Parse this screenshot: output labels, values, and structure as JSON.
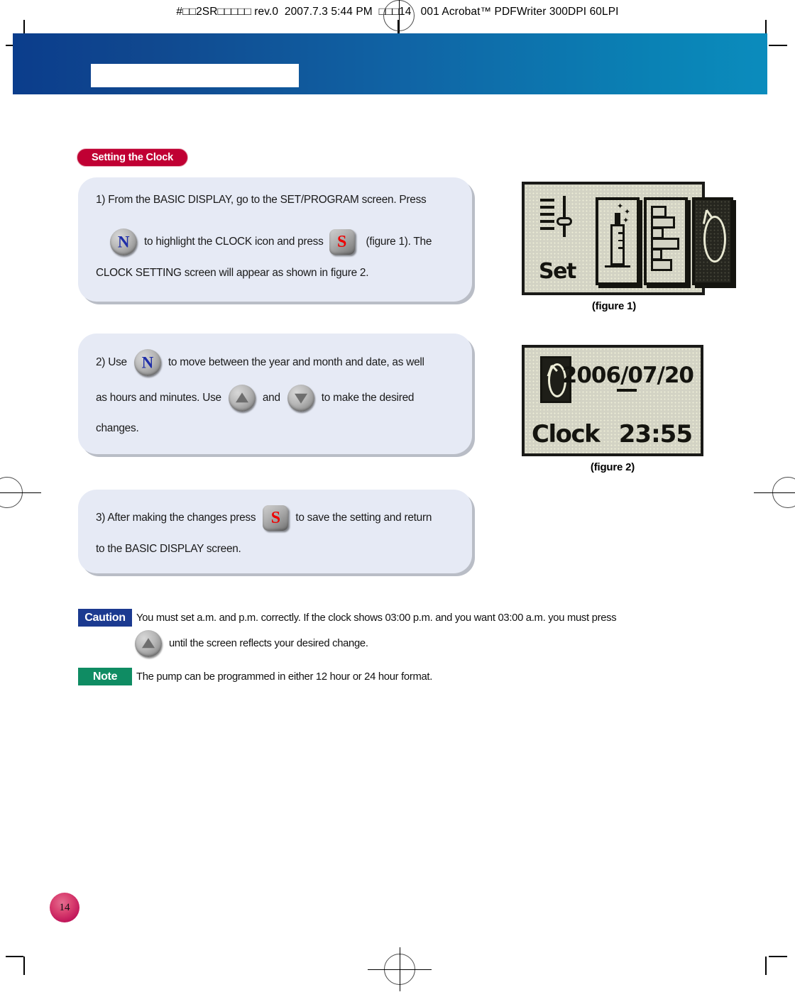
{
  "print_header": {
    "text": "#□□2SR□□□□□ rev.0  2007.7.3 5:44 PM  □□□14   001 Acrobat™ PDFWriter 300DPI 60LPI"
  },
  "section": {
    "title": "Setting the Clock"
  },
  "steps": [
    {
      "id": "step-1",
      "line1_pre": "1) From the BASIC DISPLAY, go to the SET/PROGRAM screen. Press",
      "line2_pre": "",
      "line2_mid": "to highlight the CLOCK icon and press",
      "line2_post": "(figure 1). The",
      "line3": "CLOCK SETTING screen will appear as shown in figure 2."
    },
    {
      "id": "step-2",
      "line1_pre": "2) Use",
      "line1_post": "to move between the year and month and date, as well",
      "line2_pre": "as hours and minutes. Use",
      "line2_mid": "and",
      "line2_post": "to make the desired",
      "line3": "changes."
    },
    {
      "id": "step-3",
      "line1_pre": "3) After making the changes press",
      "line1_post": "to save the setting and return",
      "line2": "to the BASIC DISPLAY screen."
    }
  ],
  "figures": [
    {
      "id": "figure-1",
      "caption": "(figure 1)",
      "lcd_label": "Set",
      "highlighted_icon": "clock"
    },
    {
      "id": "figure-2",
      "caption": "(figure 2)",
      "date": "2006/07/20",
      "label": "Clock",
      "time": "23:55",
      "underlined_field": "07"
    }
  ],
  "caution": {
    "label": "Caution",
    "line1": "You must set a.m. and p.m. correctly. If the clock shows 03:00 p.m. and you want 03:00 a.m. you must press",
    "line2": "until the screen reflects your desired change."
  },
  "note": {
    "label": "Note",
    "text": "The pump can be programmed in either 12 hour or 24 hour format."
  },
  "page_number": "14",
  "colors": {
    "banner_start": "#0b3d8c",
    "banner_end": "#0b8cbd",
    "section_pill": "#c00033",
    "box_fill": "#e6eaf5",
    "caution_tag": "#1b3a90",
    "note_tag": "#0f8c63",
    "page_badge": "#c2185b",
    "lcd_bg": "#d3d3c4",
    "btn_n_letter": "#1f2ea8",
    "btn_s_letter": "#ee0000"
  }
}
